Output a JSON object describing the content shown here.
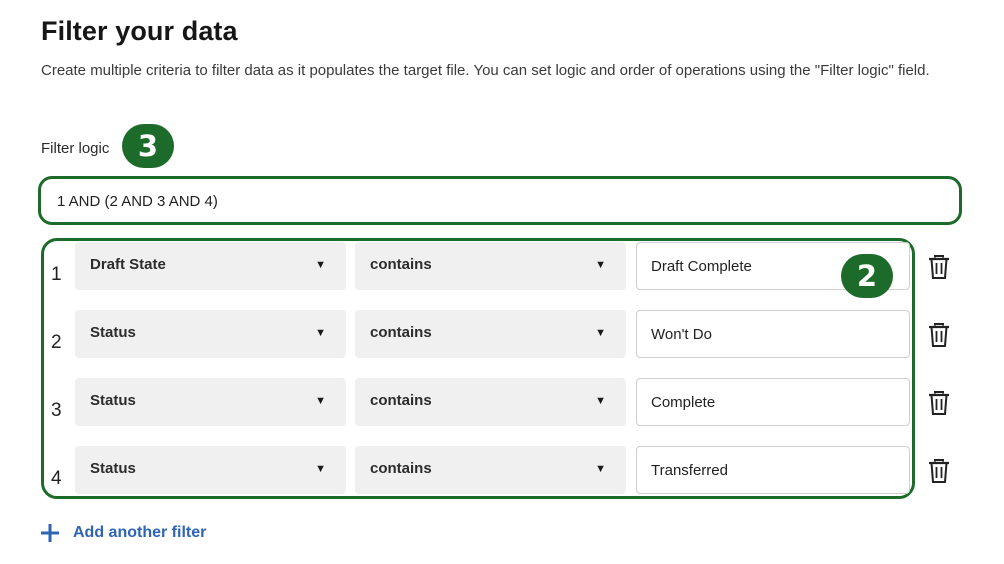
{
  "header": {
    "title": "Filter your data",
    "description": "Create multiple criteria to filter data as it populates the target file. You can set logic and order of operations using the \"Filter logic\" field."
  },
  "filter_logic": {
    "label": "Filter logic",
    "value": "1 AND (2 AND 3 AND 4)"
  },
  "badges": {
    "logic": "3",
    "rows": "2"
  },
  "filters": [
    {
      "index": "1",
      "field": "Draft State",
      "operator": "contains",
      "value": "Draft Complete"
    },
    {
      "index": "2",
      "field": "Status",
      "operator": "contains",
      "value": "Won't Do"
    },
    {
      "index": "3",
      "field": "Status",
      "operator": "contains",
      "value": "Complete"
    },
    {
      "index": "4",
      "field": "Status",
      "operator": "contains",
      "value": "Transferred"
    }
  ],
  "add_filter_label": "Add another filter",
  "icons": {
    "dropdown": "caret-down-icon",
    "delete": "trash-icon",
    "add": "plus-icon"
  },
  "colors": {
    "highlight": "#1d6b2a",
    "link": "#2f64b5",
    "select_bg": "#f0f0f0"
  }
}
